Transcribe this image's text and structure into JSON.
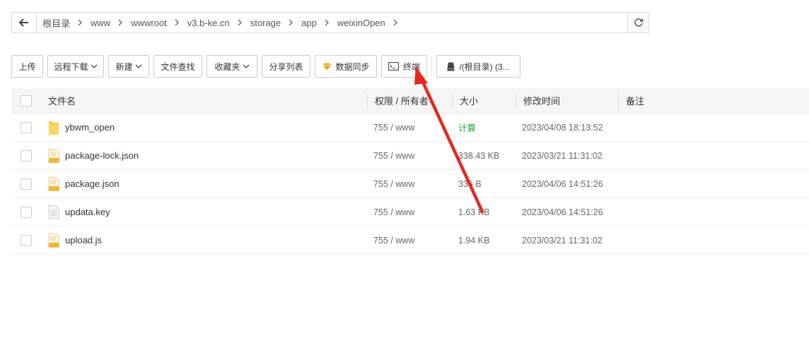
{
  "path": {
    "crumbs": [
      "根目录",
      "www",
      "wwwroot",
      "v3.b-ke.cn",
      "storage",
      "app",
      "weixinOpen"
    ]
  },
  "toolbar": {
    "upload": "上传",
    "remote_download": "远程下载",
    "new": "新建",
    "file_search": "文件查找",
    "favorites": "收藏夹",
    "share_list": "分享列表",
    "data_sync": "数据同步",
    "terminal": "终端",
    "disk": "/(根目录) (3..."
  },
  "table": {
    "headers": {
      "name": "文件名",
      "perm": "权限 / 所有者",
      "size": "大小",
      "mtime": "修改时间",
      "note": "备注"
    },
    "rows": [
      {
        "name": "ybwm_open",
        "type": "folder",
        "perm": "755 / www",
        "size": "计算",
        "mtime": "2023/04/08 18:13:52"
      },
      {
        "name": "package-lock.json",
        "type": "json",
        "perm": "755 / www",
        "size": "338.43 KB",
        "mtime": "2023/03/21 11:31:02"
      },
      {
        "name": "package.json",
        "type": "json",
        "perm": "755 / www",
        "size": "336 B",
        "mtime": "2023/04/06 14:51:26"
      },
      {
        "name": "updata.key",
        "type": "text",
        "perm": "755 / www",
        "size": "1.63 KB",
        "mtime": "2023/04/06 14:51:26"
      },
      {
        "name": "upload.js",
        "type": "js",
        "perm": "755 / www",
        "size": "1.94 KB",
        "mtime": "2023/03/21 11:31:02"
      }
    ]
  },
  "colors": {
    "accent_green": "#20a53a",
    "annotation_red": "#e8261f",
    "folder_yellow": "#f7c845"
  }
}
